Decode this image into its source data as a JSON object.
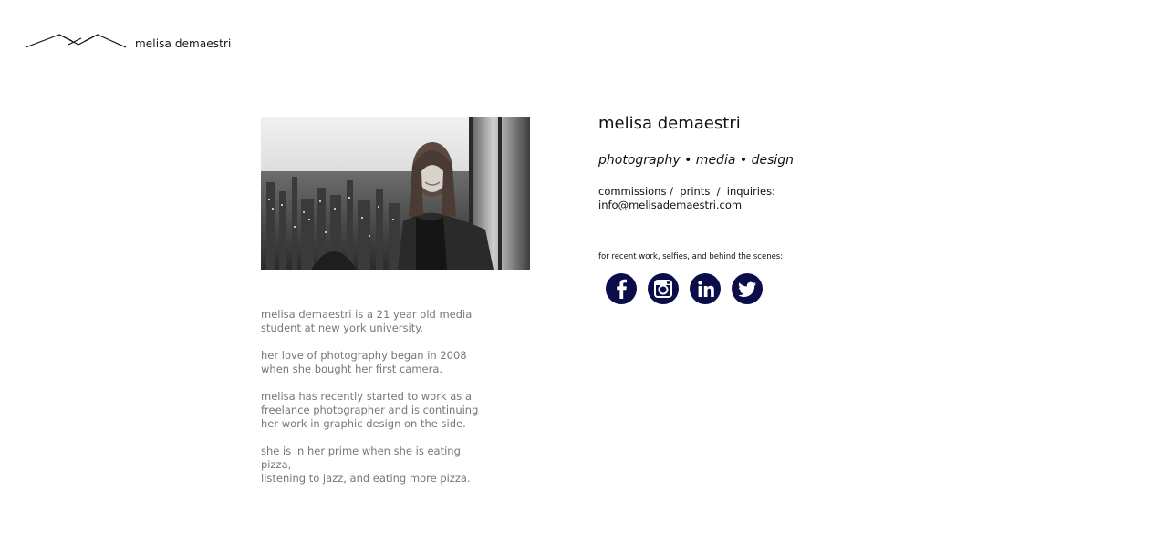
{
  "header": {
    "logo_icon": "mountain-m-icon",
    "brand_name": "melisa demaestri"
  },
  "profile": {
    "photo_alt": "portrait-photo"
  },
  "bio": {
    "paragraphs": [
      [
        "melisa demaestri is a 21 year old media",
        "student at new york university."
      ],
      [
        "her love of photography began in 2008",
        "when she bought her first camera."
      ],
      [
        "melisa has recently started to work as a",
        "freelance photographer and is continuing",
        "her work in graphic design on the side."
      ],
      [
        "she is in her prime when she is eating pizza,",
        "listening to jazz, and eating more pizza."
      ]
    ]
  },
  "about": {
    "heading": "melisa demaestri",
    "tagline": "photography • media • design",
    "contact_line": "commissions /  prints  /  inquiries:",
    "email": "info@melisademaestri.com",
    "social_label": "for recent work, selfies, and behind the scenes:"
  },
  "social": [
    {
      "name": "facebook",
      "icon": "facebook-icon"
    },
    {
      "name": "instagram",
      "icon": "instagram-icon"
    },
    {
      "name": "linkedin",
      "icon": "linkedin-icon"
    },
    {
      "name": "twitter",
      "icon": "twitter-icon"
    }
  ],
  "colors": {
    "social_bg": "#0b0c4a",
    "bio_text": "#777777",
    "text": "#111111"
  }
}
